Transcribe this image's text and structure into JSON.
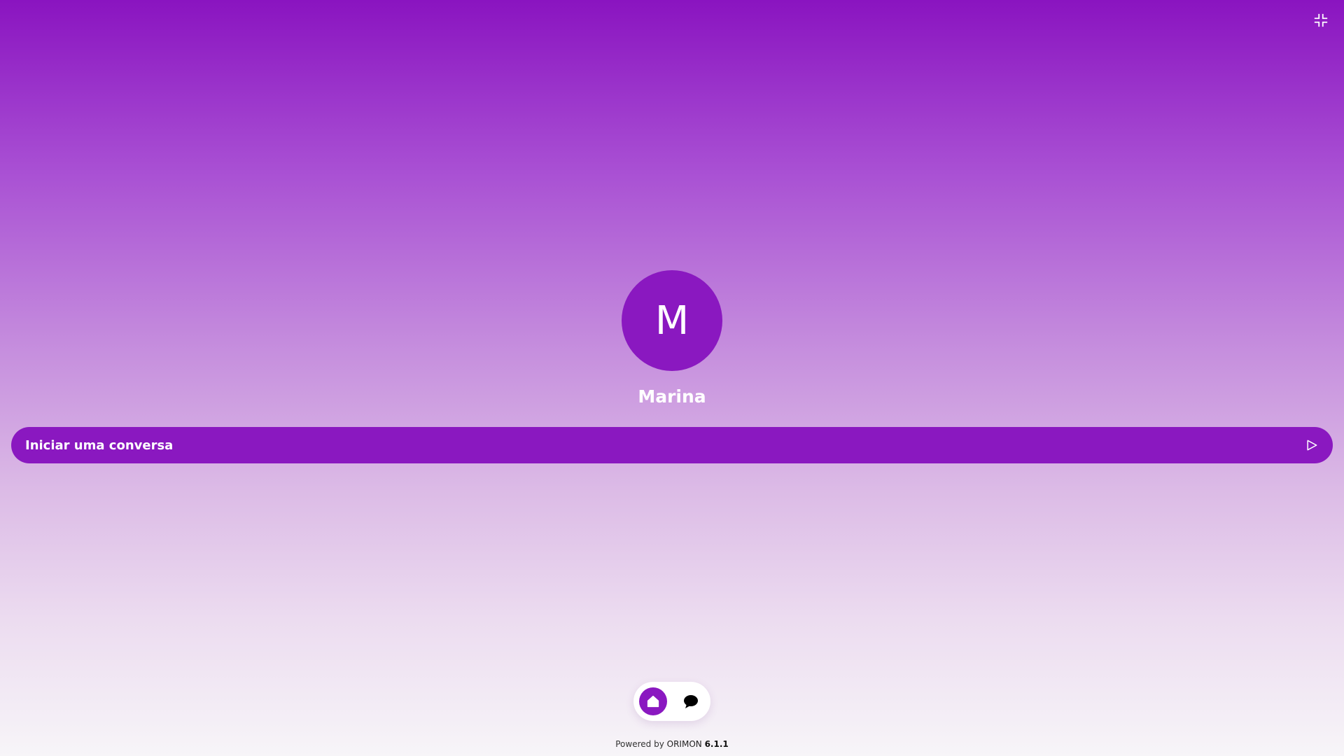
{
  "colors": {
    "accent": "#8a18c0",
    "gradient_top": "#8a14c0",
    "gradient_bottom": "#f7f5f8",
    "text_on_accent": "#ffffff"
  },
  "header": {
    "collapse_icon": "collapse-icon"
  },
  "agent": {
    "initial": "M",
    "name": "Marina"
  },
  "chat_bar": {
    "label": "Iniciar uma conversa",
    "icon": "send-icon"
  },
  "bottom_nav": {
    "items": [
      {
        "icon": "home-icon",
        "active": true
      },
      {
        "icon": "chat-bubble-icon",
        "active": false
      }
    ]
  },
  "footer": {
    "powered_by": "Powered by",
    "brand": "ORIMON",
    "version": "6.1.1"
  }
}
